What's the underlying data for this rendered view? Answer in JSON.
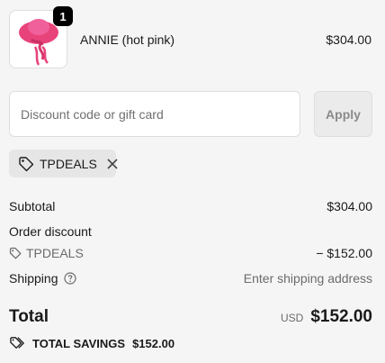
{
  "line_item": {
    "quantity": "1",
    "name": "ANNIE (hot pink)",
    "price": "$304.00",
    "image_icon": "hot-pink-hat-image"
  },
  "discount": {
    "placeholder": "Discount code or gift card",
    "value": "",
    "apply_label": "Apply"
  },
  "applied_code": {
    "code": "TPDEALS",
    "icon": "tag-icon",
    "remove_icon": "close-icon"
  },
  "summary": {
    "subtotal_label": "Subtotal",
    "subtotal_value": "$304.00",
    "order_discount_label": "Order discount",
    "discount_code": "TPDEALS",
    "discount_value": "− $152.00",
    "shipping_label": "Shipping",
    "shipping_value": "Enter shipping address",
    "total_label": "Total",
    "currency": "USD",
    "total_value": "$152.00",
    "savings_label": "TOTAL SAVINGS",
    "savings_value": "$152.00"
  },
  "colors": {
    "background": "#f5f5f5",
    "chip": "#e6e6e6",
    "hat": "#e8437a",
    "text": "#1a1a1a",
    "muted": "#6b6b6b"
  }
}
